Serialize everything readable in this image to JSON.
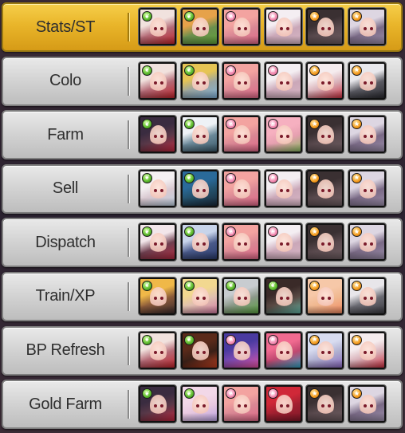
{
  "element_colors": {
    "leaf": "#58b52c",
    "water": "#f28ab0",
    "fire": "#f39a1c"
  },
  "rows": [
    {
      "label": "Stats/ST",
      "active": true,
      "units": [
        {
          "element": "leaf",
          "hair": "#f1e2de",
          "accent": "#c0242c",
          "bg": "#b46a76"
        },
        {
          "element": "leaf",
          "hair": "#e6a24a",
          "accent": "#5fa03a",
          "bg": "#6a8f4d"
        },
        {
          "element": "water",
          "hair": "#f3a3a0",
          "accent": "#e06888",
          "bg": "#d98794"
        },
        {
          "element": "water",
          "hair": "#f4eef2",
          "accent": "#d7b6c4",
          "bg": "#caa7b8"
        },
        {
          "element": "fire",
          "hair": "#3a3032",
          "accent": "#6a5a5e",
          "bg": "#5a4a4e"
        },
        {
          "element": "fire",
          "hair": "#ddd6e2",
          "accent": "#9a8ca8",
          "bg": "#7a6a86"
        }
      ]
    },
    {
      "label": "Colo",
      "active": false,
      "units": [
        {
          "element": "leaf",
          "hair": "#f1e2de",
          "accent": "#c0242c",
          "bg": "#b46a76"
        },
        {
          "element": "leaf",
          "hair": "#e6c454",
          "accent": "#7fb0d8",
          "bg": "#9aa4a0"
        },
        {
          "element": "water",
          "hair": "#f3a3a0",
          "accent": "#e06888",
          "bg": "#d98794"
        },
        {
          "element": "water",
          "hair": "#f4eef2",
          "accent": "#d7b6c4",
          "bg": "#caa7b8"
        },
        {
          "element": "fire",
          "hair": "#f5ecee",
          "accent": "#c83040",
          "bg": "#d8b0b8"
        },
        {
          "element": "fire",
          "hair": "#e8e8ec",
          "accent": "#2a2a30",
          "bg": "#5a5a62"
        }
      ]
    },
    {
      "label": "Farm",
      "active": false,
      "units": [
        {
          "element": "leaf",
          "hair": "#3a2c40",
          "accent": "#c02840",
          "bg": "#5a3848"
        },
        {
          "element": "leaf",
          "hair": "#eef2f6",
          "accent": "#3a5868",
          "bg": "#6a8898"
        },
        {
          "element": "water",
          "hair": "#f3a3a0",
          "accent": "#e06888",
          "bg": "#d98794"
        },
        {
          "element": "water",
          "hair": "#f6b0c0",
          "accent": "#8ab860",
          "bg": "#e6a0b0"
        },
        {
          "element": "fire",
          "hair": "#3a3032",
          "accent": "#6a5a5e",
          "bg": "#5a4a4e"
        },
        {
          "element": "fire",
          "hair": "#ddd6e2",
          "accent": "#9a8ca8",
          "bg": "#7a6a86"
        }
      ]
    },
    {
      "label": "Sell",
      "active": false,
      "units": [
        {
          "element": "leaf",
          "hair": "#f4f0f2",
          "accent": "#c0d0e0",
          "bg": "#d8c8d0"
        },
        {
          "element": "leaf",
          "hair": "#2a6a9a",
          "accent": "#1a2a3a",
          "bg": "#24506a"
        },
        {
          "element": "water",
          "hair": "#f3a3a0",
          "accent": "#e06888",
          "bg": "#d98794"
        },
        {
          "element": "water",
          "hair": "#f4eef2",
          "accent": "#d7b6c4",
          "bg": "#caa7b8"
        },
        {
          "element": "fire",
          "hair": "#3a3032",
          "accent": "#6a5a5e",
          "bg": "#5a4a4e"
        },
        {
          "element": "fire",
          "hair": "#ddd6e2",
          "accent": "#9a8ca8",
          "bg": "#7a6a86"
        }
      ]
    },
    {
      "label": "Dispatch",
      "active": false,
      "units": [
        {
          "element": "leaf",
          "hair": "#f2e6ea",
          "accent": "#b02a40",
          "bg": "#704050"
        },
        {
          "element": "leaf",
          "hair": "#c8d4ea",
          "accent": "#2a3a6a",
          "bg": "#4a5a8a"
        },
        {
          "element": "water",
          "hair": "#f3a3a0",
          "accent": "#e06888",
          "bg": "#d98794"
        },
        {
          "element": "water",
          "hair": "#f4eef2",
          "accent": "#d7b6c4",
          "bg": "#caa7b8"
        },
        {
          "element": "fire",
          "hair": "#3a3032",
          "accent": "#6a5a5e",
          "bg": "#5a4a4e"
        },
        {
          "element": "fire",
          "hair": "#ddd6e2",
          "accent": "#9a8ca8",
          "bg": "#7a6a86"
        }
      ]
    },
    {
      "label": "Train/XP",
      "active": false,
      "units": [
        {
          "element": "leaf",
          "hair": "#f0b848",
          "accent": "#3a2a2a",
          "bg": "#8a5a3a"
        },
        {
          "element": "leaf",
          "hair": "#f2d890",
          "accent": "#d07aa0",
          "bg": "#e0c0b0"
        },
        {
          "element": "leaf",
          "hair": "#c8ccd0",
          "accent": "#5aa040",
          "bg": "#8a9888"
        },
        {
          "element": "leaf",
          "hair": "#3a2a28",
          "accent": "#60b0a0",
          "bg": "#5a4a44"
        },
        {
          "element": "fire",
          "hair": "#f6c8a8",
          "accent": "#f08860",
          "bg": "#f0b890"
        },
        {
          "element": "fire",
          "hair": "#e8e6ea",
          "accent": "#3a3a40",
          "bg": "#6a6a72"
        }
      ]
    },
    {
      "label": "BP Refresh",
      "active": false,
      "units": [
        {
          "element": "leaf",
          "hair": "#f1e2de",
          "accent": "#c0242c",
          "bg": "#b46a76"
        },
        {
          "element": "leaf",
          "hair": "#5a2a1a",
          "accent": "#c04020",
          "bg": "#3a2018"
        },
        {
          "element": "water",
          "hair": "#4a3aa0",
          "accent": "#e050a0",
          "bg": "#7a4ab0"
        },
        {
          "element": "water",
          "hair": "#f06a90",
          "accent": "#30a0c0",
          "bg": "#c04870"
        },
        {
          "element": "fire",
          "hair": "#d8dcf0",
          "accent": "#8a6ac0",
          "bg": "#b0b0d0"
        },
        {
          "element": "fire",
          "hair": "#f5ecee",
          "accent": "#c83040",
          "bg": "#d8b0b8"
        },
        {
          "element": "fire",
          "hair": "#ddd6e2",
          "accent": "#9a8ca8",
          "bg": "#7a6a86"
        }
      ]
    },
    {
      "label": "Gold Farm",
      "active": false,
      "units": [
        {
          "element": "leaf",
          "hair": "#3a2c40",
          "accent": "#c02840",
          "bg": "#5a3848"
        },
        {
          "element": "leaf",
          "hair": "#f2d8e8",
          "accent": "#b8a0e0",
          "bg": "#e8c8e0"
        },
        {
          "element": "water",
          "hair": "#f3a3a0",
          "accent": "#e06888",
          "bg": "#d98794"
        },
        {
          "element": "water",
          "hair": "#d02838",
          "accent": "#801828",
          "bg": "#a02030"
        },
        {
          "element": "fire",
          "hair": "#3a3032",
          "accent": "#6a5a5e",
          "bg": "#5a4a4e"
        },
        {
          "element": "fire",
          "hair": "#ddd6e2",
          "accent": "#9a8ca8",
          "bg": "#7a6a86"
        }
      ]
    }
  ]
}
